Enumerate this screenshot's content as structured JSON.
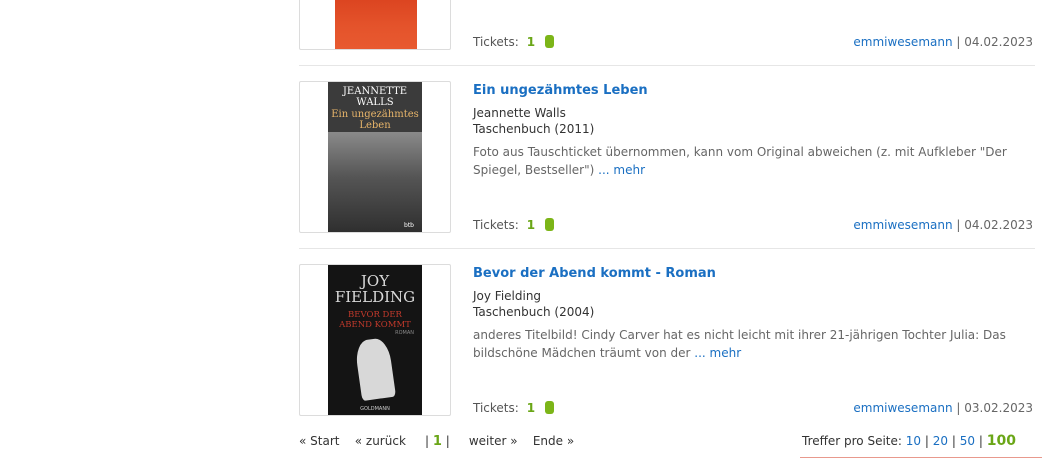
{
  "labels": {
    "tickets": "Tickets:",
    "separator": "|"
  },
  "colors": {
    "link": "#1a6fc2",
    "accent_green": "#7cb518",
    "cover_orange": "#e4532b"
  },
  "items": [
    {
      "title": "",
      "tickets": "1",
      "user": "emmiwesemann",
      "date": "04.02.2023"
    },
    {
      "title": "Ein ungezähmtes Leben",
      "author": "Jeannette Walls",
      "format": "Taschenbuch (2011)",
      "description": "Foto aus Tauschticket übernommen, kann vom Original abweichen (z. mit Aufkleber \"Der Spiegel, Bestseller\")",
      "more": "... mehr",
      "tickets": "1",
      "user": "emmiwesemann",
      "date": "04.02.2023",
      "cover": {
        "author_line1": "JEANNETTE",
        "author_line2": "WALLS",
        "title_line1": "Ein ungezähmtes",
        "title_line2": "Leben",
        "publisher": "btb"
      }
    },
    {
      "title": "Bevor der Abend kommt - Roman",
      "author": "Joy Fielding",
      "format": "Taschenbuch (2004)",
      "description": "anderes Titelbild! Cindy Carver hat es nicht leicht mit ihrer 21-jährigen Tochter Julia: Das bildschöne Mädchen träumt von der",
      "more": "... mehr",
      "tickets": "1",
      "user": "emmiwesemann",
      "date": "03.02.2023",
      "cover": {
        "author_line1": "JOY",
        "author_line2": "FIELDING",
        "title_line1": "BEVOR DER",
        "title_line2": "ABEND KOMMT",
        "tag": "ROMAN",
        "publisher": "GOLDMANN"
      }
    }
  ],
  "pagination": {
    "start": "« Start",
    "prev": "« zurück",
    "current": "1",
    "next": "weiter »",
    "end": "Ende »"
  },
  "per_page": {
    "label": "Treffer pro Seite:",
    "options": [
      "10",
      "20",
      "50",
      "100"
    ],
    "selected": "100"
  }
}
